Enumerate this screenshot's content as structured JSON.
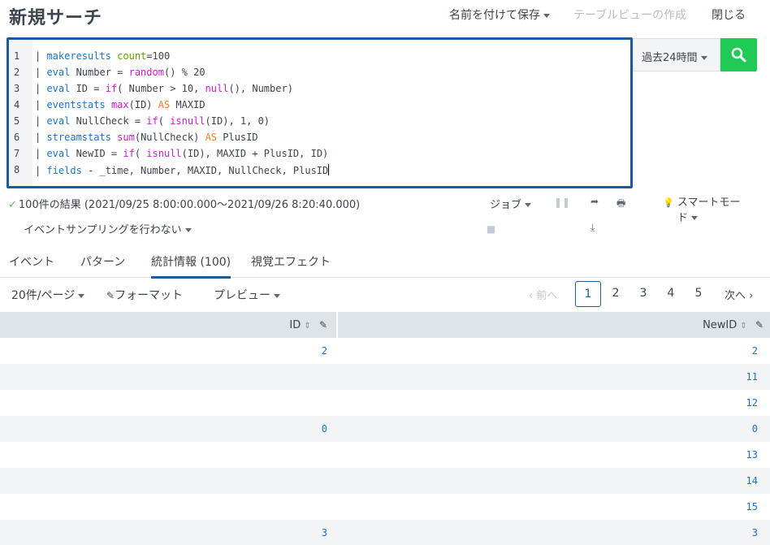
{
  "header": {
    "title": "新規サーチ",
    "save_as": "名前を付けて保存",
    "create_table_view": "テーブルビューの作成",
    "close": "閉じる"
  },
  "editor": {
    "lines": [
      {
        "num": "1"
      },
      {
        "num": "2"
      },
      {
        "num": "3"
      },
      {
        "num": "4"
      },
      {
        "num": "5"
      },
      {
        "num": "6"
      },
      {
        "num": "7"
      },
      {
        "num": "8"
      }
    ],
    "code": [
      [
        [
          "pipe",
          "| "
        ],
        [
          "cmd",
          "makeresults"
        ],
        [
          "pipe",
          " "
        ],
        [
          "arg",
          "count"
        ],
        [
          "pipe",
          "=100"
        ]
      ],
      [
        [
          "pipe",
          "| "
        ],
        [
          "cmd",
          "eval"
        ],
        [
          "pipe",
          " Number = "
        ],
        [
          "func",
          "random"
        ],
        [
          "pipe",
          "() % 20"
        ]
      ],
      [
        [
          "pipe",
          "| "
        ],
        [
          "cmd",
          "eval"
        ],
        [
          "pipe",
          " ID = "
        ],
        [
          "func",
          "if"
        ],
        [
          "pipe",
          "( Number > 10, "
        ],
        [
          "func",
          "null"
        ],
        [
          "pipe",
          "(), Number)"
        ]
      ],
      [
        [
          "pipe",
          "| "
        ],
        [
          "cmd",
          "eventstats"
        ],
        [
          "pipe",
          " "
        ],
        [
          "func",
          "max"
        ],
        [
          "pipe",
          "(ID) "
        ],
        [
          "kw",
          "AS"
        ],
        [
          "pipe",
          " MAXID"
        ]
      ],
      [
        [
          "pipe",
          "| "
        ],
        [
          "cmd",
          "eval"
        ],
        [
          "pipe",
          " NullCheck = "
        ],
        [
          "func",
          "if"
        ],
        [
          "pipe",
          "( "
        ],
        [
          "func",
          "isnull"
        ],
        [
          "pipe",
          "(ID), 1, 0)"
        ]
      ],
      [
        [
          "pipe",
          "| "
        ],
        [
          "cmd",
          "streamstats"
        ],
        [
          "pipe",
          " "
        ],
        [
          "func",
          "sum"
        ],
        [
          "pipe",
          "(NullCheck) "
        ],
        [
          "kw",
          "AS"
        ],
        [
          "pipe",
          " PlusID"
        ]
      ],
      [
        [
          "pipe",
          "| "
        ],
        [
          "cmd",
          "eval"
        ],
        [
          "pipe",
          " NewID = "
        ],
        [
          "func",
          "if"
        ],
        [
          "pipe",
          "( "
        ],
        [
          "func",
          "isnull"
        ],
        [
          "pipe",
          "(ID), MAXID + PlusID, ID)"
        ]
      ],
      [
        [
          "pipe",
          "| "
        ],
        [
          "cmd",
          "fields"
        ],
        [
          "pipe",
          " - _time, Number, MAXID, NullCheck, PlusID"
        ]
      ]
    ]
  },
  "time_picker": {
    "label": "過去24時間"
  },
  "status": {
    "results": "100件の結果 (2021/09/25 8:00:00.000〜2021/09/26 8:20:40.000)",
    "sampling": "イベントサンプリングを行わない",
    "job": "ジョブ",
    "smart_mode_line1": "スマートモー",
    "smart_mode_line2": "ド"
  },
  "tabs": [
    {
      "label": "イベント"
    },
    {
      "label": "パターン"
    },
    {
      "label": "統計情報 (100)"
    },
    {
      "label": "視覚エフェクト"
    }
  ],
  "toolbar": {
    "per_page": "20件/ページ",
    "format": "フォーマット",
    "preview": "プレビュー",
    "prev": "前へ",
    "next": "次へ",
    "pages": [
      "1",
      "2",
      "3",
      "4",
      "5"
    ],
    "current_page": "1"
  },
  "table": {
    "columns": [
      "ID",
      "NewID"
    ],
    "rows": [
      {
        "id": "2",
        "newid": "2"
      },
      {
        "id": "",
        "newid": "11"
      },
      {
        "id": "",
        "newid": "12"
      },
      {
        "id": "0",
        "newid": "0"
      },
      {
        "id": "",
        "newid": "13"
      },
      {
        "id": "",
        "newid": "14"
      },
      {
        "id": "",
        "newid": "15"
      },
      {
        "id": "3",
        "newid": "3"
      }
    ]
  },
  "colors": {
    "accent": "#1a5c9e",
    "search_button": "#1fca55",
    "value_text": "#1a72c7"
  },
  "icons": {
    "search": "search-icon",
    "pause": "pause-icon",
    "share": "share-icon",
    "print": "print-icon",
    "stop": "stop-icon",
    "export": "export-icon",
    "smart_mode": "lightbulb-icon",
    "edit": "pencil-icon",
    "sort": "sort-icon"
  }
}
